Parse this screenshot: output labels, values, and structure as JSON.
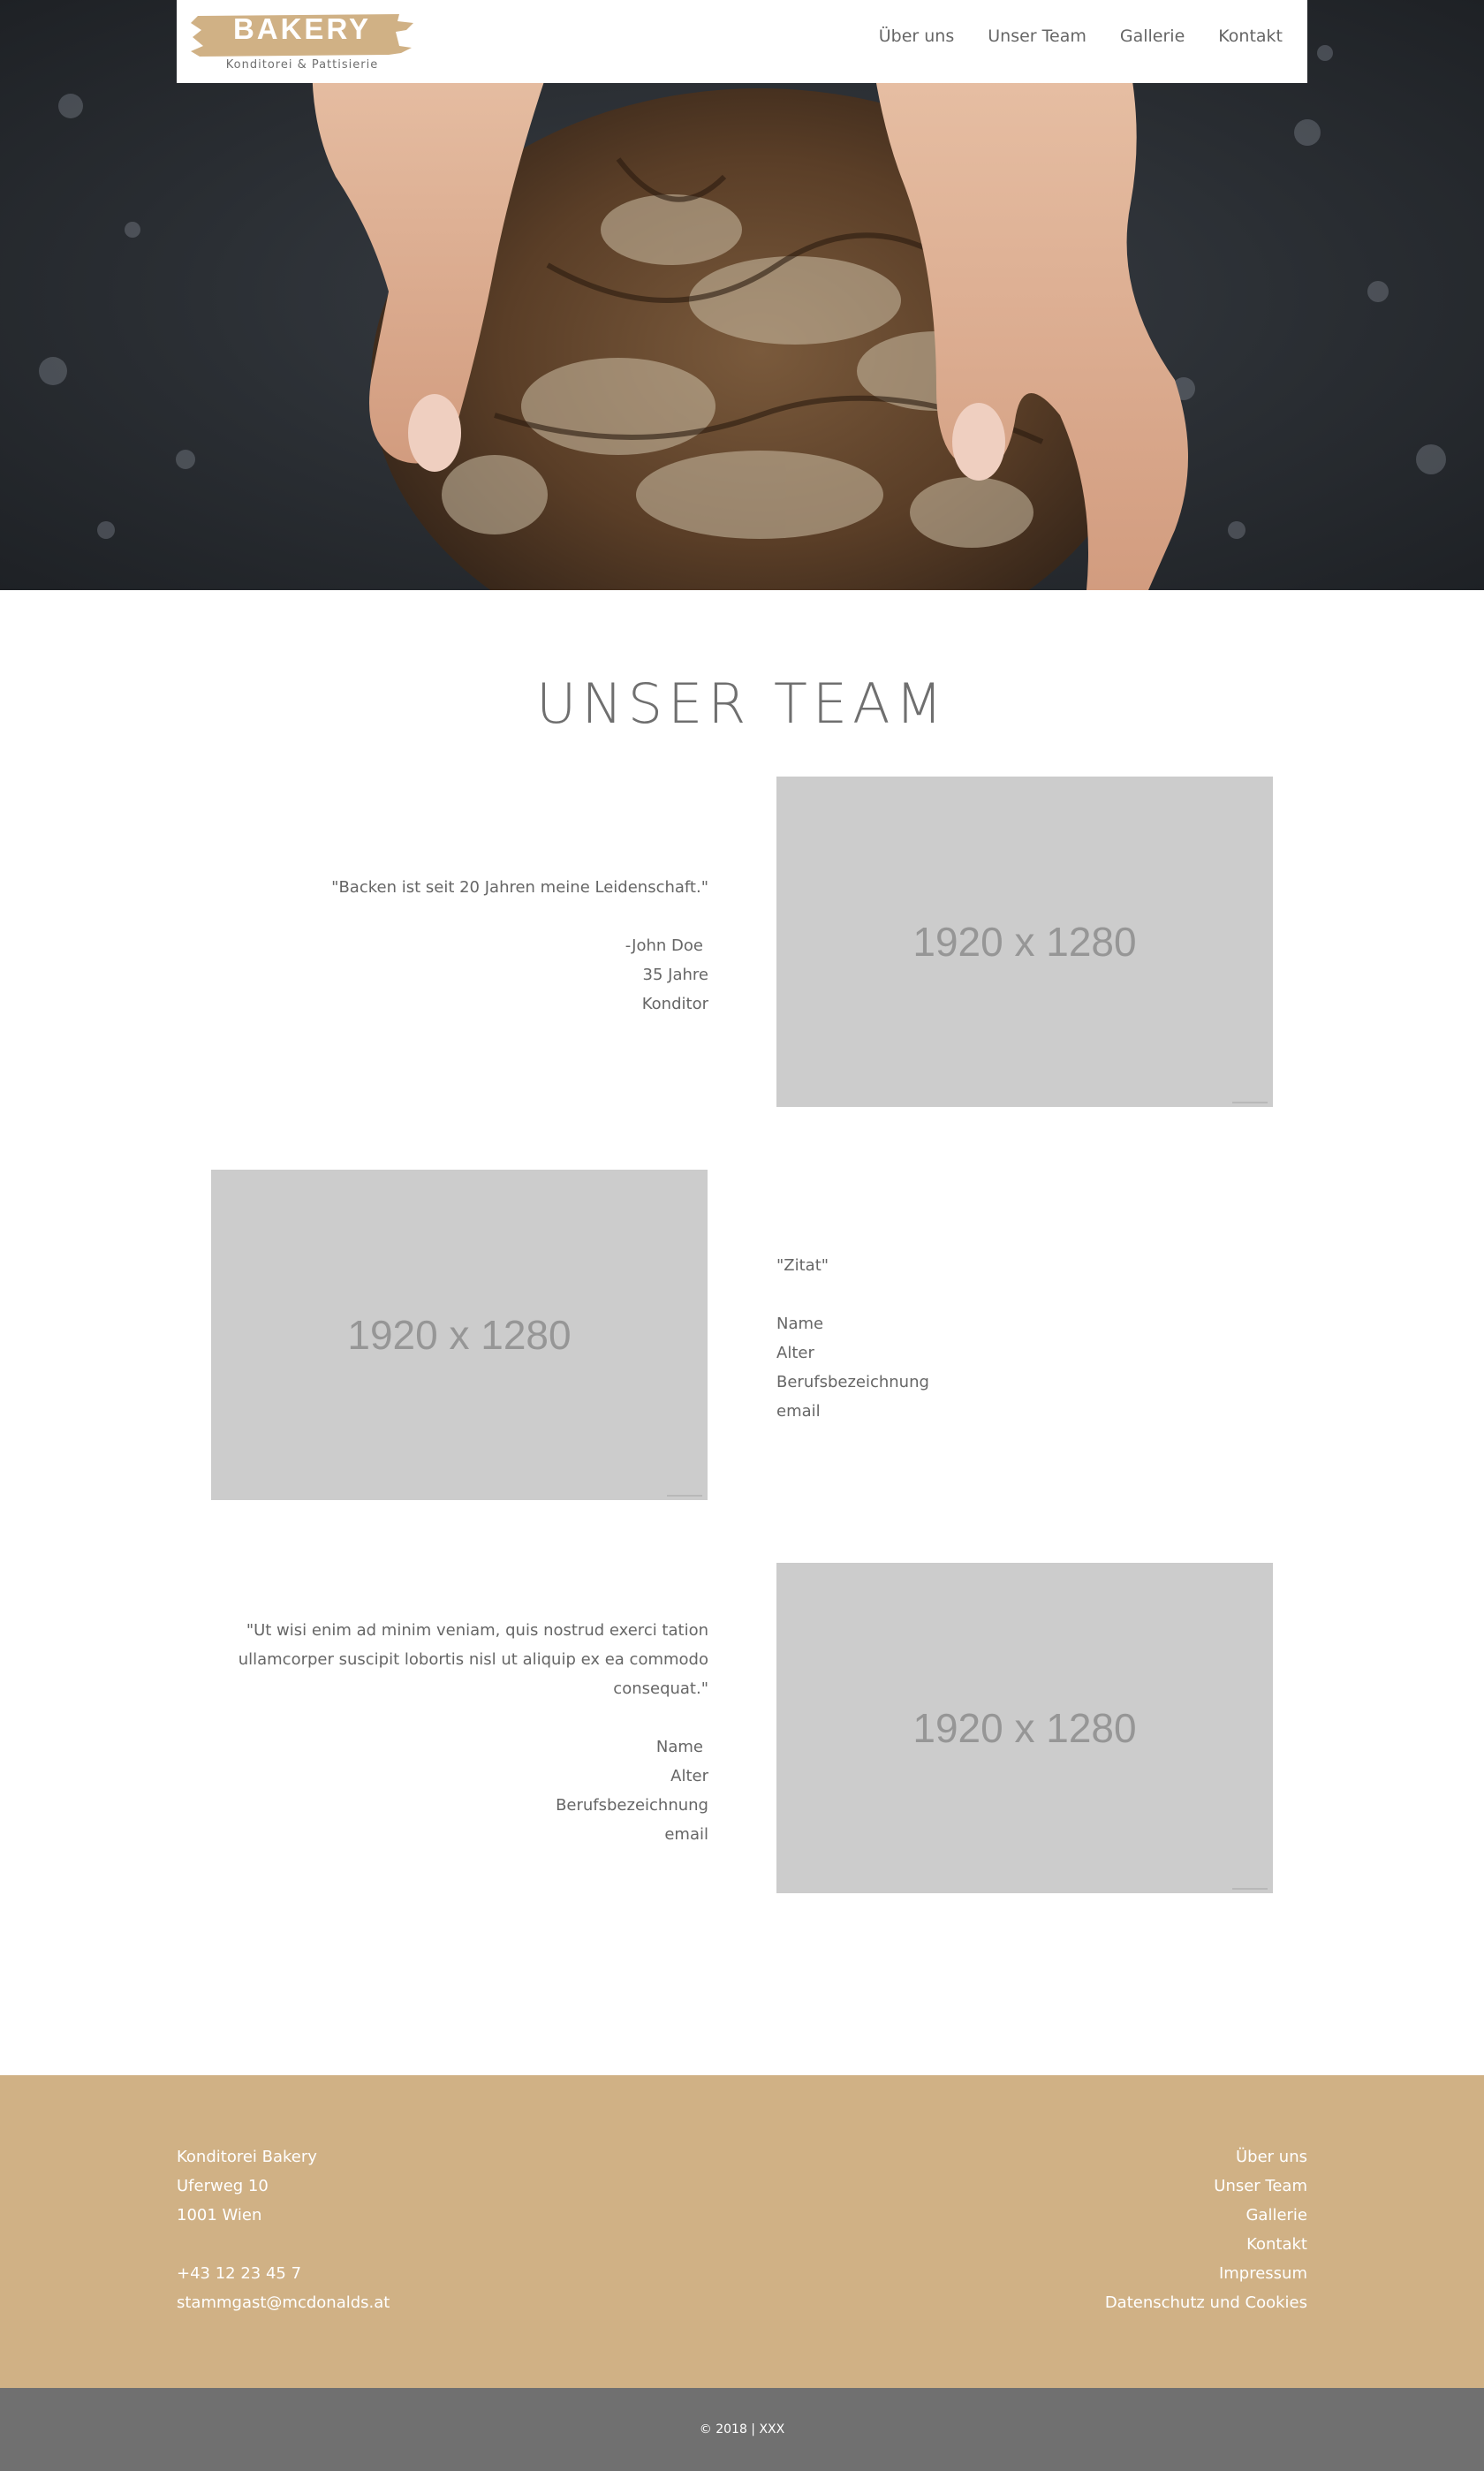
{
  "brand": {
    "name": "BAKERY",
    "tagline": "Konditorei & Pattisierie",
    "color": "#d0b185"
  },
  "nav": {
    "items": [
      {
        "label": "Über uns"
      },
      {
        "label": "Unser Team"
      },
      {
        "label": "Gallerie"
      },
      {
        "label": "Kontakt"
      }
    ]
  },
  "hero": {
    "image": "hands-holding-bread-loaf"
  },
  "team": {
    "title": "UNSER TEAM",
    "placeholder_label": "1920 x 1280",
    "members": [
      {
        "quote": "\"Backen ist seit 20 Jahren meine Leidenschaft.\"",
        "name": "-John Doe",
        "age": "35 Jahre",
        "job": "Konditor"
      },
      {
        "quote": "\"Zitat\"",
        "name": "Name",
        "age": "Alter",
        "job": "Berufsbezeichnung",
        "email": "email"
      },
      {
        "quote": "\"Ut wisi enim ad minim veniam, quis nostrud exerci tation ullamcorper suscipit lobortis nisl ut aliquip ex ea commodo consequat.\"",
        "name": "Name",
        "age": "Alter",
        "job": "Berufsbezeichnung",
        "email": "email"
      }
    ]
  },
  "footer": {
    "address": {
      "company": "Konditorei Bakery",
      "street": "Uferweg 10",
      "city": "1001 Wien",
      "phone": "+43 12 23 45 7",
      "email": "stammgast@mcdonalds.at"
    },
    "links": [
      {
        "label": "Über uns"
      },
      {
        "label": "Unser Team"
      },
      {
        "label": "Gallerie"
      },
      {
        "label": "Kontakt"
      },
      {
        "label": "Impressum"
      },
      {
        "label": "Datenschutz und Cookies"
      }
    ],
    "copyright": "© 2018 | XXX"
  }
}
